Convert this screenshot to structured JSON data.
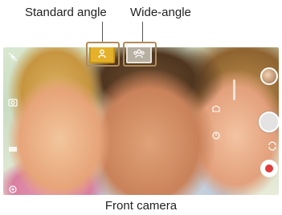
{
  "callouts": {
    "standard_label": "Standard angle",
    "wide_label": "Wide-angle"
  },
  "camera": {
    "lens_buttons": [
      {
        "name": "standard-angle",
        "icon": "person-icon",
        "glyph": "☖"
      },
      {
        "name": "wide-angle",
        "icon": "group-icon",
        "glyph": "☗"
      }
    ],
    "left_icons": [
      {
        "icon": "flash-off-icon",
        "glyph": "⚡"
      },
      {
        "icon": "mode-icon",
        "glyph": "◎"
      },
      {
        "icon": "settings-icon",
        "glyph": "▣"
      },
      {
        "icon": "filter-icon",
        "glyph": "❀"
      }
    ],
    "accent_color": "#e5b12a",
    "record_color": "#e03a3a"
  },
  "caption": "Front camera"
}
